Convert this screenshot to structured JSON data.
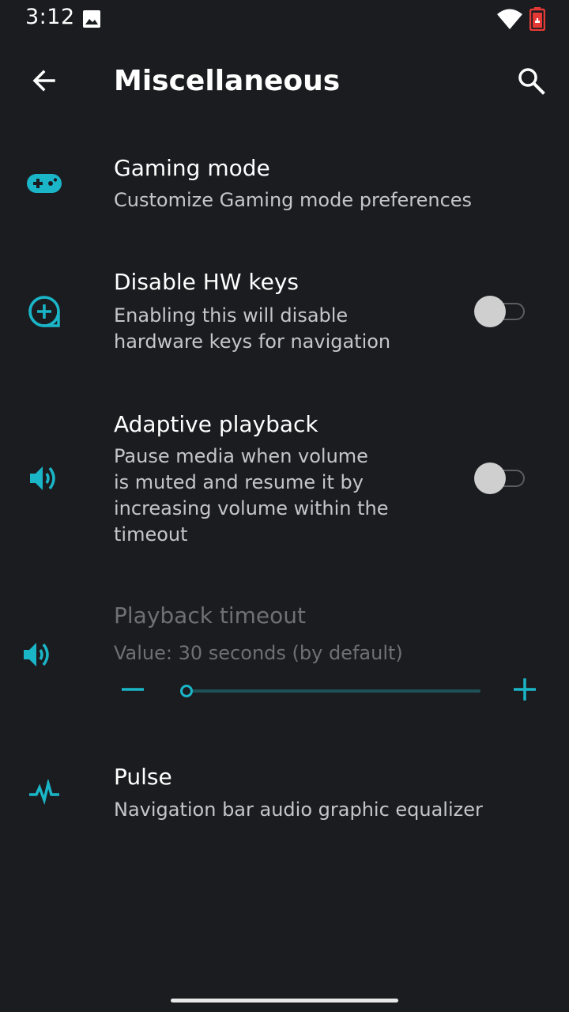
{
  "status_bar": {
    "time": "3:12",
    "icons": [
      "image-notification-icon",
      "wifi-icon",
      "battery-icon"
    ],
    "battery_color": "#e53935"
  },
  "app_bar": {
    "title": "Miscellaneous",
    "back_icon": "arrow-left-icon",
    "search_icon": "search-icon"
  },
  "accent_color": "#1ab6c8",
  "preferences": [
    {
      "icon": "gamepad-icon",
      "title": "Gaming mode",
      "summary": "Customize Gaming mode preferences"
    },
    {
      "icon": "plus-circle-icon",
      "title": "Disable HW keys",
      "summary_lines": [
        "Enabling this will disable",
        "hardware keys for navigation"
      ],
      "switch_on": false
    },
    {
      "icon": "volume-icon",
      "title": "Adaptive playback",
      "summary_lines": [
        "Pause media when volume",
        "is muted and resume it by",
        "increasing volume within the",
        "timeout"
      ],
      "switch_on": false
    },
    {
      "icon": "volume-icon",
      "title": "Playback timeout",
      "summary": "Value: 30 seconds (by default)",
      "disabled": true,
      "slider_value_fraction": 0.0
    },
    {
      "icon": "pulse-icon",
      "title": "Pulse",
      "summary": "Navigation bar audio graphic equalizer"
    }
  ]
}
